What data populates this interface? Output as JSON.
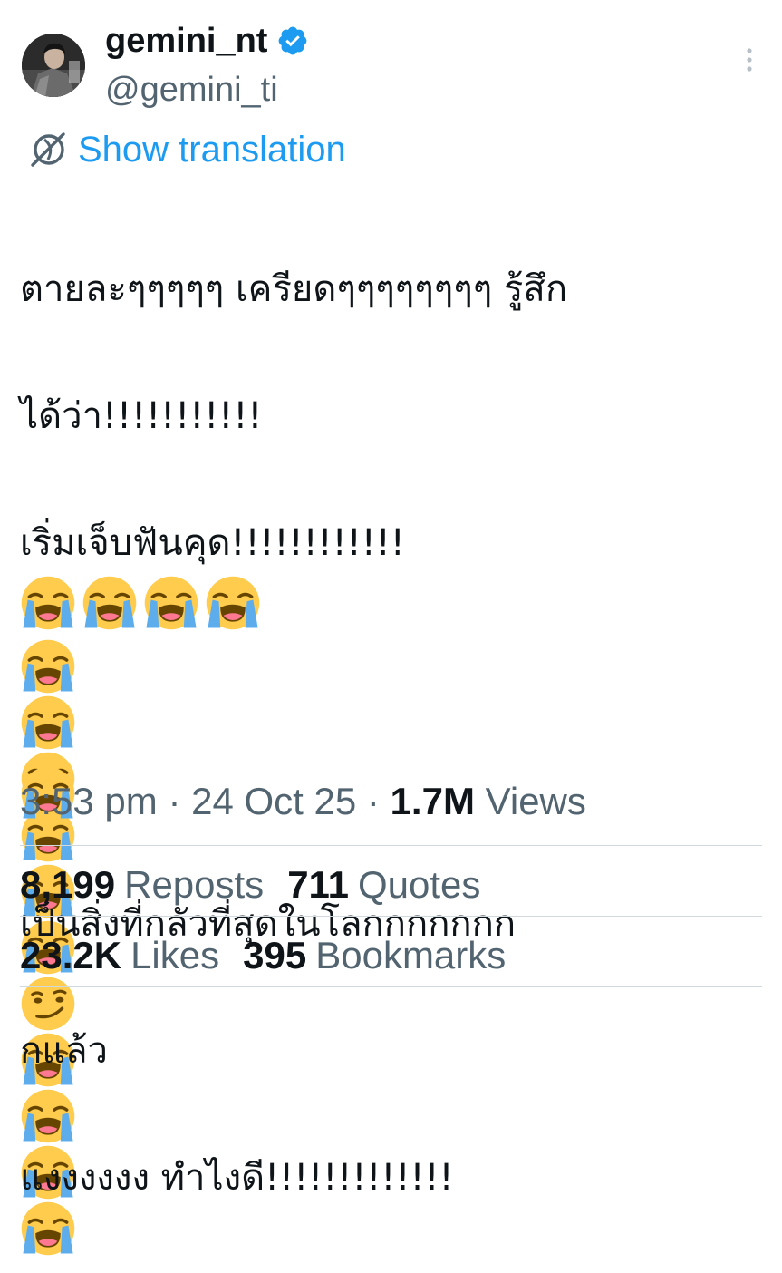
{
  "author": {
    "display_name": "gemini_nt",
    "handle": "@gemini_ti",
    "verified": true,
    "avatar_icon": "avatar-photo"
  },
  "actions": {
    "more_icon": "more-vertical-icon",
    "translate_icon": "translate-globe-icon",
    "show_translation": "Show translation"
  },
  "tweet": {
    "line1": "ตายละๆๆๆๆๆ เครียดๆๆๆๆๆๆๆๆ รู้สึก",
    "line2": "ได้ว่า!!!!!!!!!!!",
    "line3": "เริ่มเจ็บฟันคุด!!!!!!!!!!!!",
    "line3_emojis": [
      "loudly-crying-face",
      "loudly-crying-face",
      "loudly-crying-face",
      "loudly-crying-face"
    ],
    "line4_emojis": [
      "loudly-crying-face",
      "loudly-crying-face",
      "loudly-crying-face",
      "loudly-crying-face",
      "loudly-crying-face",
      "loudly-crying-face",
      "smirking-face",
      "loudly-crying-face",
      "loudly-crying-face",
      "loudly-crying-face",
      "loudly-crying-face"
    ],
    "line5_emojis": [
      "loudly-crying-face"
    ],
    "line6": "เป็นสิ่งที่กลัวที่สุดในโลกกกกกกก",
    "line7": "กแล้ว",
    "line8": "แงงงงงง ทำไงดี!!!!!!!!!!!!!"
  },
  "meta": {
    "time": "3:53 pm",
    "separator": "·",
    "date": "24 Oct 25",
    "views_count": "1.7M",
    "views_label": "Views"
  },
  "stats": {
    "reposts_count": "8,199",
    "reposts_label": "Reposts",
    "quotes_count": "711",
    "quotes_label": "Quotes",
    "likes_count": "23.2K",
    "likes_label": "Likes",
    "bookmarks_count": "395",
    "bookmarks_label": "Bookmarks"
  },
  "colors": {
    "link_blue": "#1d9bf0",
    "secondary_text": "#536471",
    "primary_text": "#0f1419",
    "divider": "#cfd9de",
    "emoji_yellow": "#ffcc4d",
    "tear_blue": "#5dadec"
  }
}
